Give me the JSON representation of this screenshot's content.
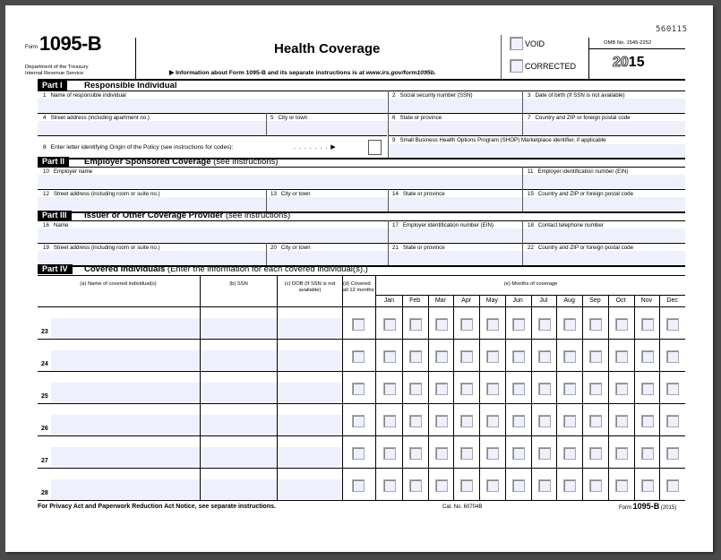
{
  "header": {
    "form_prefix": "Form",
    "form_number": "1095-B",
    "agency_line1": "Department of the Treasury",
    "agency_line2": "Internal Revenue Service",
    "title": "Health Coverage",
    "info_text": "▶ Information about Form 1095-B and its separate instructions is at",
    "info_url": "www.irs.gov/form1095b.",
    "void_label": "VOID",
    "corrected_label": "CORRECTED",
    "control_number": "560115",
    "omb": "OMB No. 1545-2252",
    "year_outline": "20",
    "year_bold": "15"
  },
  "part1": {
    "tag": "Part I",
    "title": "Responsible Individual",
    "fields": {
      "f1": {
        "num": "1",
        "label": "Name of responsible individual"
      },
      "f2": {
        "num": "2",
        "label": "Social security number (SSN)"
      },
      "f3": {
        "num": "3",
        "label": "Date of birth (If SSN is not available)"
      },
      "f4": {
        "num": "4",
        "label": "Street address (including apartment no.)"
      },
      "f5": {
        "num": "5",
        "label": "City or town"
      },
      "f6": {
        "num": "6",
        "label": "State or province"
      },
      "f7": {
        "num": "7",
        "label": "Country and ZIP or foreign postal code"
      },
      "f8": {
        "num": "8",
        "label": "Enter letter identifying Origin of the Policy (see instructions for codes):",
        "leader": ". . . . . . . ▶"
      },
      "f9": {
        "num": "9",
        "label": "Small Business Health Options Program (SHOP) Marketplace identifier, if applicable"
      }
    }
  },
  "part2": {
    "tag": "Part II",
    "title": "Employer Sponsored Coverage",
    "title_note": "(see instructions)",
    "fields": {
      "f10": {
        "num": "10",
        "label": "Employer name"
      },
      "f11": {
        "num": "11",
        "label": "Employer identification number (EIN)"
      },
      "f12": {
        "num": "12",
        "label": "Street address (including room or suite no.)"
      },
      "f13": {
        "num": "13",
        "label": "City or town"
      },
      "f14": {
        "num": "14",
        "label": "State or province"
      },
      "f15": {
        "num": "15",
        "label": "Country and ZIP or foreign postal code"
      }
    }
  },
  "part3": {
    "tag": "Part III",
    "title": "Issuer or Other Coverage Provider",
    "title_note": "(see instructions)",
    "fields": {
      "f16": {
        "num": "16",
        "label": "Name"
      },
      "f17": {
        "num": "17",
        "label": "Employer identification number (EIN)"
      },
      "f18": {
        "num": "18",
        "label": "Contact telephone number"
      },
      "f19": {
        "num": "19",
        "label": "Street address (including room or suite no.)"
      },
      "f20": {
        "num": "20",
        "label": "City or town"
      },
      "f21": {
        "num": "21",
        "label": "State or province"
      },
      "f22": {
        "num": "22",
        "label": "Country and ZIP or foreign postal code"
      }
    }
  },
  "part4": {
    "tag": "Part IV",
    "title": "Covered Individuals",
    "title_note": "(Enter the information for each covered individual(s).)",
    "col_a": "(a) Name of covered individual(s)",
    "col_b": "(b) SSN",
    "col_c": "(c) DOB (If SSN is not available)",
    "col_d": "(d) Covered all 12 months",
    "col_e": "(e) Months of coverage",
    "months": [
      "Jan",
      "Feb",
      "Mar",
      "Apr",
      "May",
      "Jun",
      "Jul",
      "Aug",
      "Sep",
      "Oct",
      "Nov",
      "Dec"
    ],
    "rows": [
      "23",
      "24",
      "25",
      "26",
      "27",
      "28"
    ]
  },
  "footer": {
    "privacy": "For Privacy Act and Paperwork Reduction Act Notice, see separate instructions.",
    "cat_no": "Cat. No. 60704B",
    "form_prefix": "Form",
    "form_number": "1095-B",
    "form_year": "(2015)"
  }
}
